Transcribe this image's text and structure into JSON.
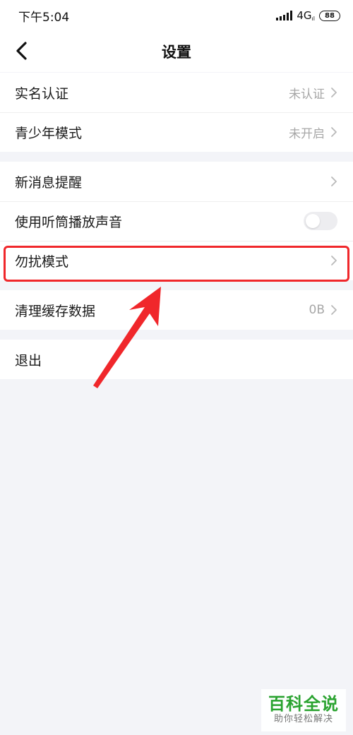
{
  "status_bar": {
    "time": "下午5:04",
    "network": "4G",
    "network_sub": "ıl",
    "battery": "88"
  },
  "header": {
    "title": "设置",
    "back_icon": "chevron-left-icon"
  },
  "groups": [
    {
      "items": [
        {
          "label": "实名认证",
          "value": "未认证",
          "accessory": "chevron"
        },
        {
          "label": "青少年模式",
          "value": "未开启",
          "accessory": "chevron"
        }
      ]
    },
    {
      "items": [
        {
          "label": "新消息提醒",
          "value": "",
          "accessory": "chevron"
        },
        {
          "label": "使用听筒播放声音",
          "value": "",
          "accessory": "toggle",
          "toggle_on": false
        },
        {
          "label": "勿扰模式",
          "value": "",
          "accessory": "chevron",
          "highlighted": true
        }
      ]
    },
    {
      "items": [
        {
          "label": "清理缓存数据",
          "value": "0B",
          "accessory": "chevron"
        }
      ]
    },
    {
      "items": [
        {
          "label": "退出",
          "value": "",
          "accessory": "none"
        }
      ]
    }
  ],
  "annotation": {
    "highlight_color": "#f0272b",
    "arrow_color": "#f0272b"
  },
  "watermark": {
    "title": "百科全说",
    "subtitle": "助你轻松解决"
  }
}
